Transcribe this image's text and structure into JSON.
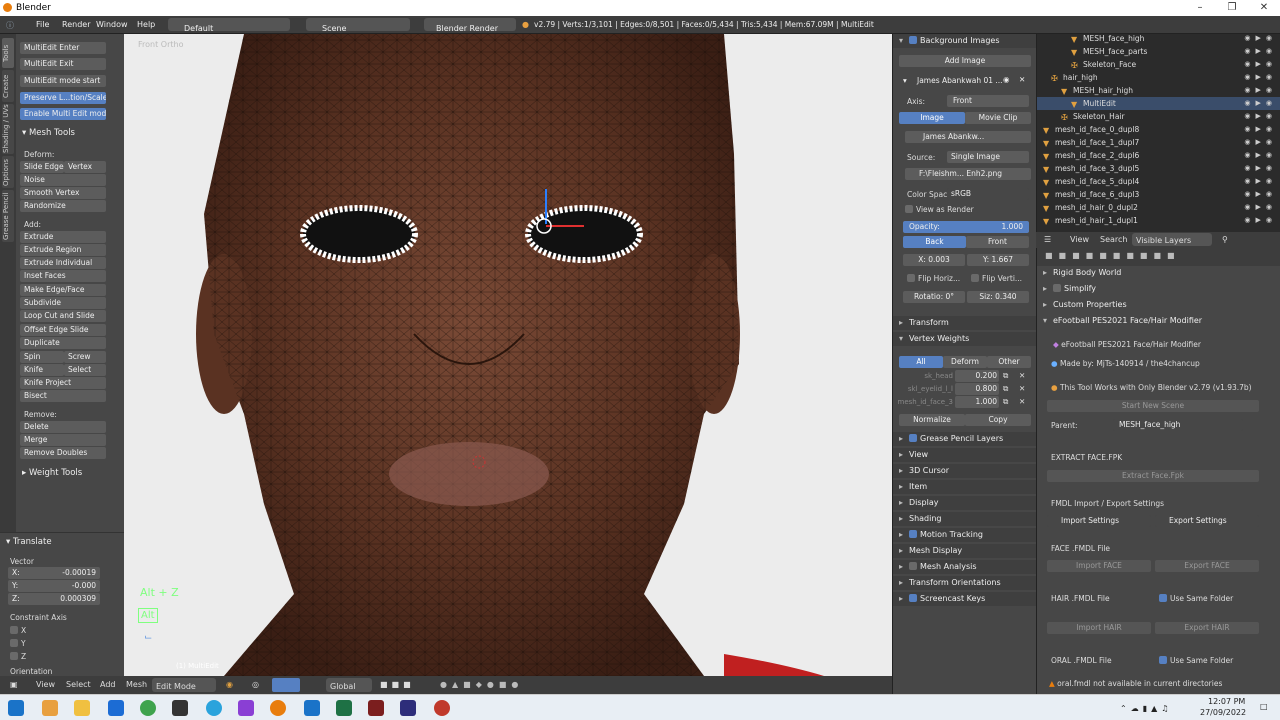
{
  "window": {
    "title": "Blender"
  },
  "menubar": {
    "items": [
      "File",
      "Render",
      "Window",
      "Help"
    ],
    "screen": "Default",
    "scene": "Scene",
    "engine": "Blender Render",
    "stats": "v2.79 | Verts:1/3,101 | Edges:0/8,501 | Faces:0/5,434 | Tris:5,434 | Mem:67.09M | MultiEdit"
  },
  "toolshelf": {
    "tabs": [
      "Tools",
      "Create",
      "Shading / UVs",
      "Options",
      "Grease Pencil"
    ],
    "multiedit": [
      "MultiEdit Enter",
      "MultiEdit Exit",
      "MultiEdit mode start",
      "Preserve L...tion/Scale",
      "Enable Multi Edit mode"
    ],
    "mesh_tools_header": "Mesh Tools",
    "deform_label": "Deform:",
    "slide_edge": "Slide Edge",
    "vertex": "Vertex",
    "noise": "Noise",
    "smooth_vertex": "Smooth Vertex",
    "randomize": "Randomize",
    "add_label": "Add:",
    "extrude": "Extrude",
    "extrude_region": "Extrude Region",
    "extrude_individual": "Extrude Individual",
    "inset_faces": "Inset Faces",
    "make_edge_face": "Make Edge/Face",
    "subdivide": "Subdivide",
    "loop_cut": "Loop Cut and Slide",
    "offset_edge": "Offset Edge Slide",
    "duplicate": "Duplicate",
    "spin": "Spin",
    "screw": "Screw",
    "knife": "Knife",
    "select": "Select",
    "knife_project": "Knife Project",
    "bisect": "Bisect",
    "remove_label": "Remove:",
    "delete": "Delete",
    "merge": "Merge",
    "remove_doubles": "Remove Doubles",
    "weight_tools": "Weight Tools",
    "translate_header": "Translate",
    "vector_label": "Vector",
    "vx_label": "X:",
    "vx": "-0.00019",
    "vy_label": "Y:",
    "vy": "-0.000",
    "vz_label": "Z:",
    "vz": "0.000309",
    "constraint_axis": "Constraint Axis",
    "cx": "X",
    "cy": "Y",
    "cz": "Z",
    "orientation": "Orientation"
  },
  "viewport": {
    "view_label": "Front Ortho",
    "keys_hint": "Alt + Z",
    "alt_hint": "Alt",
    "object_label": "(1) MultiEdit"
  },
  "viewport_header": {
    "items": [
      "View",
      "Select",
      "Add",
      "Mesh"
    ],
    "mode": "Edit Mode",
    "orientation": "Global"
  },
  "props": {
    "bg_images": "Background Images",
    "add_image": "Add Image",
    "image_name": "James Abankwah 01 ...",
    "axis_label": "Axis:",
    "axis_value": "Front",
    "image_tab": "Image",
    "movie_tab": "Movie Clip",
    "image_file": "James Abankw...",
    "source_label": "Source:",
    "source_value": "Single Image",
    "filepath": "F:\\Fleishm... Enh2.png",
    "color_space_label": "Color Spac",
    "color_space": "sRGB",
    "view_as_render": "View as Render",
    "opacity_label": "Opacity:",
    "opacity_value": "1.000",
    "opacity": 1.0,
    "back": "Back",
    "front": "Front",
    "x_label": "X:",
    "x_value": "0.003",
    "y_label": "Y:",
    "y_value": "1.667",
    "flip_h": "Flip Horiz...",
    "flip_v": "Flip Verti...",
    "rotation": "Rotatio: 0°",
    "size": "Siz: 0.340",
    "transform": "Transform",
    "vertex_weights": "Vertex Weights",
    "vw_all": "All",
    "vw_deform": "Deform",
    "vw_other": "Other",
    "weights": [
      {
        "name": "sk_head",
        "value": "0.200"
      },
      {
        "name": "skl_eyelid_l_l",
        "value": "0.800"
      },
      {
        "name": "mesh_id_face_3",
        "value": "1.000"
      }
    ],
    "normalize": "Normalize",
    "copy": "Copy",
    "sections": [
      "Grease Pencil Layers",
      "View",
      "3D Cursor",
      "Item",
      "Display",
      "Shading",
      "Motion Tracking",
      "Mesh Display",
      "Mesh Analysis",
      "Transform Orientations",
      "Screencast Keys"
    ]
  },
  "outliner": {
    "rows": [
      {
        "name": "MESH_face_high",
        "indent": 3,
        "icon": "mesh"
      },
      {
        "name": "MESH_face_parts",
        "indent": 3,
        "icon": "mesh"
      },
      {
        "name": "Skeleton_Face",
        "indent": 3,
        "icon": "armature"
      },
      {
        "name": "hair_high",
        "indent": 1,
        "icon": "empty"
      },
      {
        "name": "MESH_hair_high",
        "indent": 2,
        "icon": "mesh"
      },
      {
        "name": "MultiEdit",
        "indent": 3,
        "icon": "mesh"
      },
      {
        "name": "Skeleton_Hair",
        "indent": 2,
        "icon": "armature"
      },
      {
        "name": "mesh_id_face_0_dupl8",
        "indent": 0,
        "icon": "mesh"
      },
      {
        "name": "mesh_id_face_1_dupl7",
        "indent": 0,
        "icon": "mesh"
      },
      {
        "name": "mesh_id_face_2_dupl6",
        "indent": 0,
        "icon": "mesh"
      },
      {
        "name": "mesh_id_face_3_dupl5",
        "indent": 0,
        "icon": "mesh"
      },
      {
        "name": "mesh_id_face_5_dupl4",
        "indent": 0,
        "icon": "mesh"
      },
      {
        "name": "mesh_id_face_6_dupl3",
        "indent": 0,
        "icon": "mesh"
      },
      {
        "name": "mesh_id_hair_0_dupl2",
        "indent": 0,
        "icon": "mesh"
      },
      {
        "name": "mesh_id_hair_1_dupl1",
        "indent": 0,
        "icon": "mesh"
      }
    ],
    "bar": {
      "view": "View",
      "search": "Search",
      "filter": "Visible Layers"
    }
  },
  "rprops": {
    "rigid_body": "Rigid Body World",
    "simplify": "Simplify",
    "custom_props": "Custom Properties",
    "addon_header": "eFootball PES2021 Face/Hair Modifier",
    "addon_title": "eFootball PES2021 Face/Hair Modifier",
    "made_by": "Made by: MjTs-140914 / the4chancup",
    "tool_note": "This Tool Works with Only Blender v2.79 (v1.93.7b)",
    "start_scene": "Start New Scene",
    "parent_label": "Parent:",
    "parent_value": "MESH_face_high",
    "extract": "EXTRACT FACE.FPK",
    "extract_btn": "Extract Face.Fpk",
    "fmdl_settings": "FMDL Import / Export Settings",
    "import_settings": "Import Settings",
    "export_settings": "Export Settings",
    "face_fmdl": "FACE .FMDL File",
    "import_face": "Import FACE",
    "export_face": "Export FACE",
    "hair_fmdl": "HAIR .FMDL File",
    "use_same_folder": "Use Same Folder",
    "import_hair": "Import HAIR",
    "export_hair": "Export HAIR",
    "oral_fmdl": "ORAL .FMDL File",
    "oral_warning": "oral.fmdl not available in current directories"
  },
  "taskbar": {
    "time": "12:07 PM",
    "date": "27/09/2022"
  },
  "colors": {
    "accent": "#5680c2",
    "panel": "#474747",
    "header": "#3d3d3d"
  }
}
